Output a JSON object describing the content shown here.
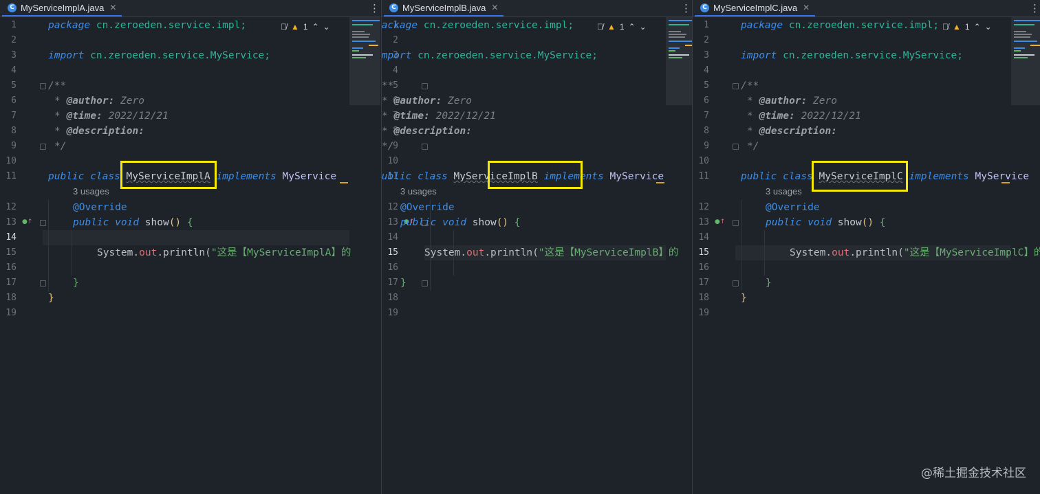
{
  "panes": [
    {
      "tab": "MyServiceImplA.java",
      "line1_pkg": "cn.zeroeden.service.impl;",
      "line3_pkg": "cn.zeroeden.service.MyService;",
      "class_name": "MyServiceImplA",
      "iface_text": "MyService",
      "print_text": "\"这是【MyServiceImplA】的",
      "warn_count": "1"
    },
    {
      "tab": "MyServiceImplB.java",
      "line1_pkg": "cn.zeroeden.service.impl;",
      "line3_pkg": "cn.zeroeden.service.MyService;",
      "class_name": "MyServiceImplB",
      "iface_text": "MyService",
      "print_text": "\"这是【MyServiceImplB】的",
      "warn_count": "1"
    },
    {
      "tab": "MyServiceImplC.java",
      "line1_pkg": "cn.zeroeden.service.impl;",
      "line3_pkg": "cn.zeroeden.service.MyService;",
      "class_name": "MyServiceImplC",
      "iface_text": "MyService",
      "print_text": "\"这是【MyServiceImplC】的",
      "warn_count": "1"
    }
  ],
  "code": {
    "kw_package": "package",
    "kw_import": "import",
    "doc_open": "/**",
    "doc_star": "*",
    "doc_author_tag": "@author:",
    "doc_author_val": "Zero",
    "doc_time_tag": "@time:",
    "doc_time_val": "2022/12/21",
    "doc_desc_tag": "@description:",
    "doc_close": "*/",
    "kw_public": "public",
    "kw_class": "class",
    "kw_implements": "implements",
    "usages": "3 usages",
    "override": "@Override",
    "kw_void": "void",
    "method_name": "show",
    "parens": "()",
    "open_brace": "{",
    "close_brace": "}",
    "system": "System.",
    "out": "out",
    "println": ".println(",
    "line_numbers": [
      "1",
      "2",
      "3",
      "4",
      "5",
      "6",
      "7",
      "8",
      "9",
      "10",
      "11",
      "12",
      "13",
      "14",
      "15",
      "16",
      "17",
      "18",
      "19"
    ]
  },
  "watermark": "@稀土掘金技术社区",
  "colors": {
    "highlight_box": "#f5e90c",
    "keyword": "#3d8ee8",
    "package": "#2fb49a",
    "string": "#6aab73",
    "field": "#e06c75",
    "warning": "#f0b429"
  },
  "icons": [
    "java-class-icon",
    "close-icon",
    "more-options-icon",
    "hide-inlay-icon",
    "warning-icon",
    "chevron-up-icon",
    "chevron-down-icon",
    "implementation-marker-icon"
  ]
}
